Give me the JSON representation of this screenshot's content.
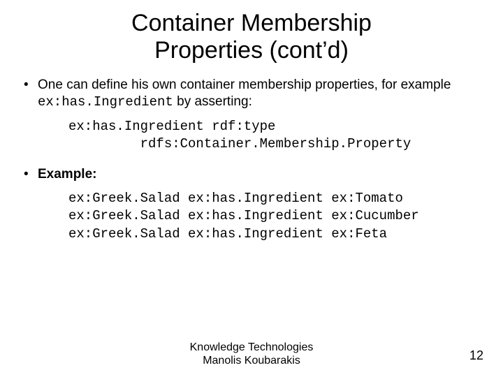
{
  "title_line1": "Container Membership",
  "title_line2": "Properties (cont’d)",
  "bullet1_pre": "One can define his own container membership properties, for example ",
  "bullet1_code": "ex:has.Ingredient",
  "bullet1_post": " by asserting:",
  "code1_line1": "ex:has.Ingredient rdf:type",
  "code1_line2": "         rdfs:Container.Membership.Property",
  "bullet2": "Example:",
  "code2_line1": "ex:Greek.Salad ex:has.Ingredient ex:Tomato",
  "code2_line2": "ex:Greek.Salad ex:has.Ingredient ex:Cucumber",
  "code2_line3": "ex:Greek.Salad ex:has.Ingredient ex:Feta",
  "footer_line1": "Knowledge Technologies",
  "footer_line2": "Manolis Koubarakis",
  "page_number": "12"
}
